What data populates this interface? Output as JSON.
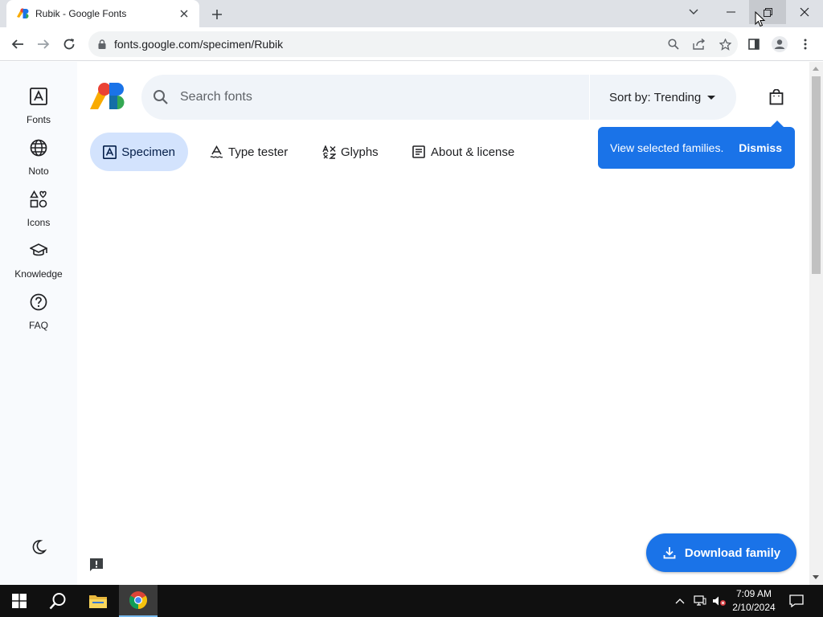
{
  "browser": {
    "tab_title": "Rubik - Google Fonts",
    "url": "fonts.google.com/specimen/Rubik"
  },
  "rail": {
    "items": [
      {
        "label": "Fonts",
        "icon": "font-box-icon"
      },
      {
        "label": "Noto",
        "icon": "globe-icon"
      },
      {
        "label": "Icons",
        "icon": "shapes-icon"
      },
      {
        "label": "Knowledge",
        "icon": "graduation-cap-icon"
      },
      {
        "label": "FAQ",
        "icon": "help-circle-icon"
      }
    ]
  },
  "search": {
    "placeholder": "Search fonts",
    "sort_label": "Sort by: Trending"
  },
  "tabs": [
    {
      "label": "Specimen",
      "active": true
    },
    {
      "label": "Type tester",
      "active": false
    },
    {
      "label": "Glyphs",
      "active": false
    },
    {
      "label": "About & license",
      "active": false
    }
  ],
  "popup": {
    "message": "View selected families.",
    "dismiss": "Dismiss"
  },
  "download": {
    "label": "Download family"
  },
  "taskbar": {
    "time": "7:09 AM",
    "date": "2/10/2024"
  },
  "colors": {
    "accent": "#1a73e8",
    "active_tab_bg": "#d3e3fd",
    "rail_bg": "#f8fafd",
    "search_bg": "#f0f4f9"
  }
}
